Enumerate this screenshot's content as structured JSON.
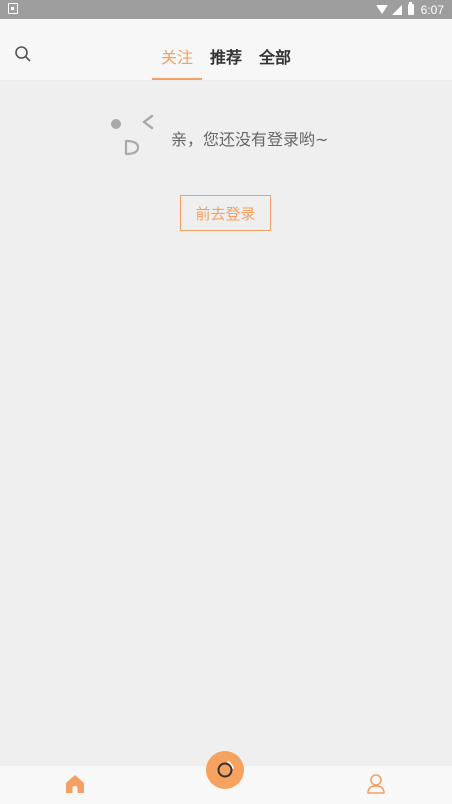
{
  "status_bar": {
    "time": "6:07"
  },
  "header": {
    "tabs": [
      {
        "label": "关注",
        "active": true
      },
      {
        "label": "推荐",
        "active": false
      },
      {
        "label": "全部",
        "active": false
      }
    ]
  },
  "empty_state": {
    "message": "亲，您还没有登录哟~",
    "login_button": "前去登录"
  },
  "colors": {
    "accent": "#f4a063",
    "status_bar": "#9e9e9e",
    "background": "#efefef"
  },
  "icons": {
    "search": "search-icon",
    "home": "home-icon",
    "center": "camera-icon",
    "profile": "user-icon"
  }
}
